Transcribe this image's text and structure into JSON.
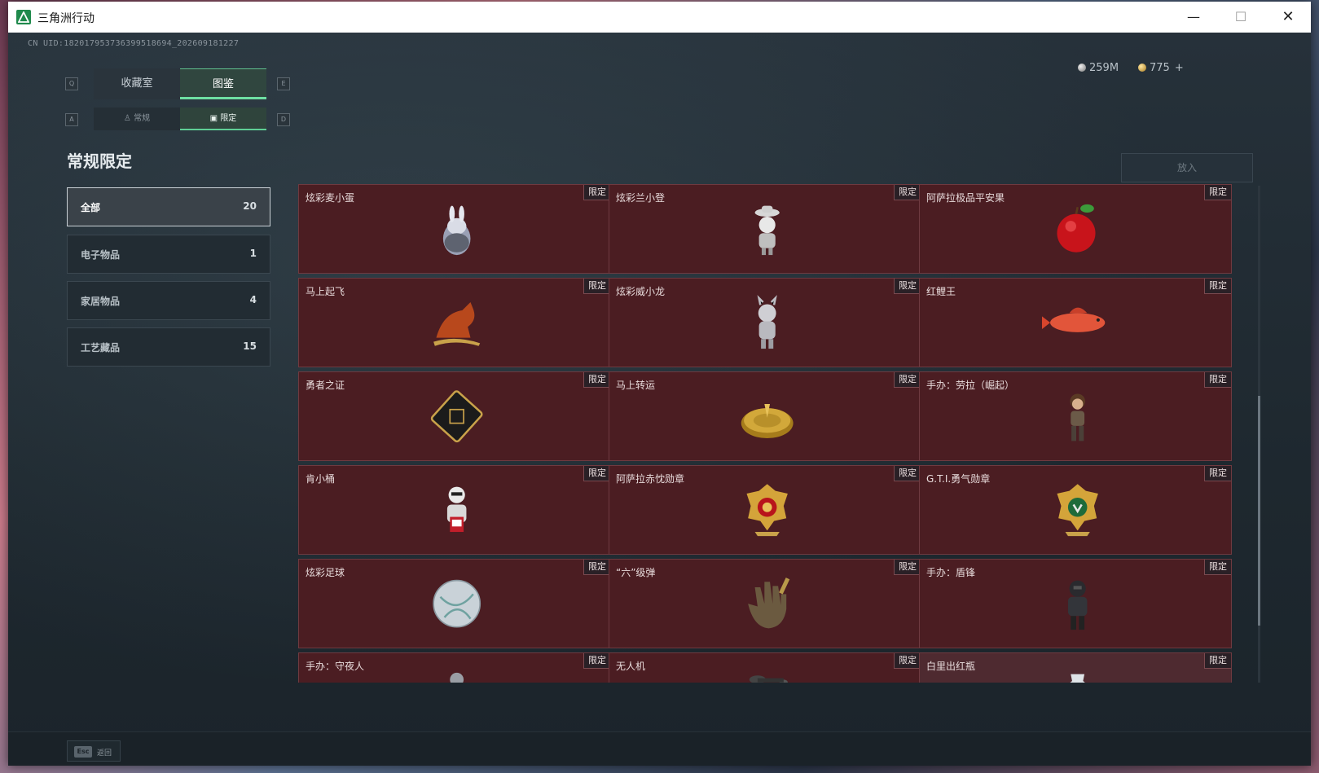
{
  "window": {
    "title": "三角洲行动"
  },
  "header": {
    "uid": "CN UID:182017953736399518694_202609181227",
    "currency_silver": "259M",
    "currency_gold": "775",
    "currency_add": "+"
  },
  "keyhints": {
    "q": "Q",
    "e": "E",
    "a": "A",
    "d": "D"
  },
  "tabs": [
    {
      "label": "收藏室",
      "active": false
    },
    {
      "label": "图鉴",
      "active": true
    }
  ],
  "subtabs": [
    {
      "label": "常规",
      "active": false
    },
    {
      "label": "限定",
      "active": true
    }
  ],
  "section_title": "常规限定",
  "categories": [
    {
      "label": "全部",
      "count": "20",
      "active": true
    },
    {
      "label": "电子物品",
      "count": "1",
      "active": false
    },
    {
      "label": "家居物品",
      "count": "4",
      "active": false
    },
    {
      "label": "工艺藏品",
      "count": "15",
      "active": false
    }
  ],
  "place_button": "放入",
  "tag_label": "限定",
  "items": [
    {
      "name": "炫彩麦小蛋",
      "icon": "rabbit-egg-figure-icon"
    },
    {
      "name": "炫彩兰小登",
      "icon": "sombrero-figure-icon"
    },
    {
      "name": "阿萨拉极品平安果",
      "icon": "apple-icon"
    },
    {
      "name": "马上起飞",
      "icon": "horse-statue-icon"
    },
    {
      "name": "炫彩威小龙",
      "icon": "dragon-figure-icon"
    },
    {
      "name": "红鲤王",
      "icon": "carp-fish-icon"
    },
    {
      "name": "勇者之证",
      "icon": "card-badge-icon"
    },
    {
      "name": "马上转运",
      "icon": "golden-wheel-icon"
    },
    {
      "name": "手办：劳拉（崛起）",
      "icon": "lara-figure-icon"
    },
    {
      "name": "肯小桶",
      "icon": "bucket-figure-icon"
    },
    {
      "name": "阿萨拉赤忱勋章",
      "icon": "red-medal-icon"
    },
    {
      "name": "G.T.I.勇气勋章",
      "icon": "green-medal-icon"
    },
    {
      "name": "炫彩足球",
      "icon": "soccer-ball-icon"
    },
    {
      "name": "“六”级弹",
      "icon": "hand-bullets-icon"
    },
    {
      "name": "手办：盾锋",
      "icon": "soldier-figure-icon"
    },
    {
      "name": "手办：守夜人",
      "icon": "figure-icon"
    },
    {
      "name": "无人机",
      "icon": "drone-icon"
    },
    {
      "name": "白里出红瓶",
      "icon": "vase-icon"
    }
  ],
  "bottom": {
    "esc_key": "Esc",
    "esc_label": "返回"
  },
  "colors": {
    "accent": "#6ee0a3",
    "card_bg": "#4b1d22",
    "card_border": "#6e3a40"
  }
}
